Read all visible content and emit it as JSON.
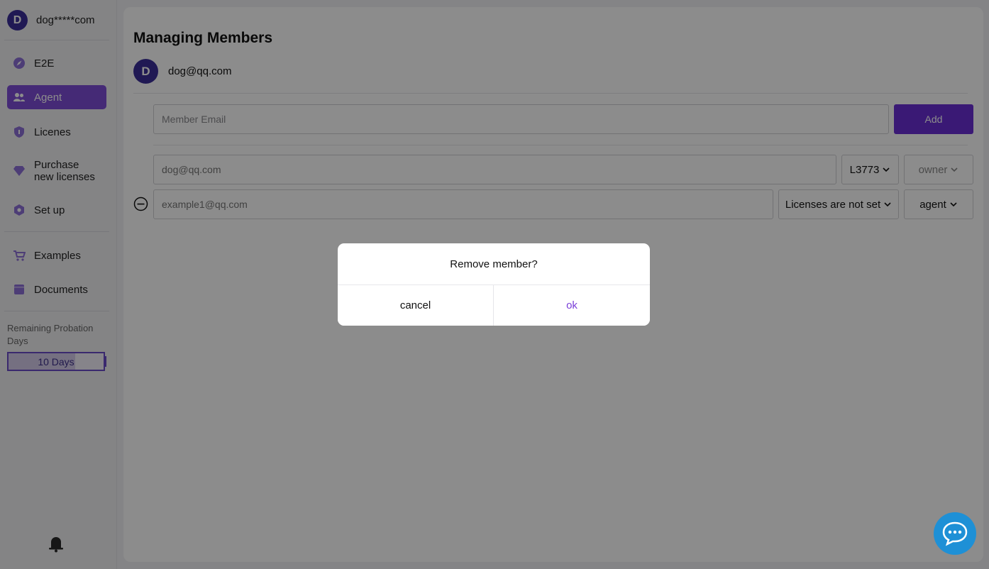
{
  "sidebar": {
    "user": {
      "initial": "D",
      "name": "dog*****com"
    },
    "items": [
      {
        "label": "E2E",
        "icon": "compass-icon"
      },
      {
        "label": "Agent",
        "icon": "users-icon",
        "active": true
      },
      {
        "label": "Licenes",
        "icon": "shield-icon"
      },
      {
        "label": "Purchase new licenses",
        "icon": "diamond-icon"
      },
      {
        "label": "Set up",
        "icon": "gear-shield-icon"
      },
      {
        "label": "Examples",
        "icon": "cart-icon"
      },
      {
        "label": "Documents",
        "icon": "folder-icon"
      }
    ],
    "probation": {
      "label": "Remaining Probation Days",
      "value": "10 Days",
      "progress": 0.7
    },
    "bell_icon": "bell-icon"
  },
  "main": {
    "title": "Managing Members",
    "owner": {
      "initial": "D",
      "email": "dog@qq.com"
    },
    "add_form": {
      "placeholder": "Member Email",
      "button": "Add"
    },
    "members": [
      {
        "email": "dog@qq.com",
        "license": "L3773",
        "role": "owner",
        "removable": false
      },
      {
        "email": "example1@qq.com",
        "license": "Licenses are not set",
        "role": "agent",
        "removable": true
      }
    ]
  },
  "dialog": {
    "title": "Remove member?",
    "cancel": "cancel",
    "ok": "ok"
  },
  "chat": {
    "icon": "chat-icon"
  },
  "colors": {
    "accent": "#7e4dd8",
    "button": "#6a2fd6",
    "avatar": "#3b2f9a",
    "chat": "#1e90d6"
  }
}
